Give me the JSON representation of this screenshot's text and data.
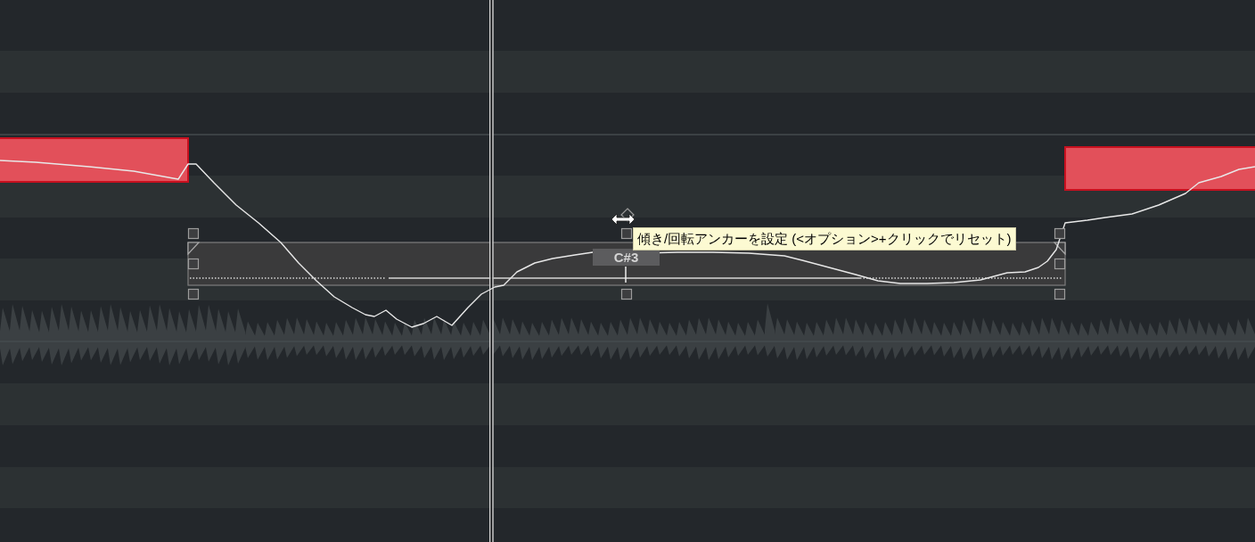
{
  "editor": {
    "lanes": [
      {
        "kind": "dark"
      },
      {
        "kind": "dark"
      },
      {
        "kind": "light"
      },
      {
        "kind": "dark"
      },
      {
        "kind": "octave"
      },
      {
        "kind": "light"
      },
      {
        "kind": "dark"
      },
      {
        "kind": "light"
      },
      {
        "kind": "dark"
      },
      {
        "kind": "dark"
      },
      {
        "kind": "light"
      },
      {
        "kind": "dark"
      },
      {
        "kind": "light"
      },
      {
        "kind": "dark"
      }
    ]
  },
  "segments": [
    {
      "active": false
    },
    {
      "active": true,
      "pitch_label": "C#3"
    },
    {
      "active": false
    }
  ],
  "tooltip": {
    "text": "傾き/回転アンカーを設定 (<オプション>+クリックでリセット)"
  }
}
